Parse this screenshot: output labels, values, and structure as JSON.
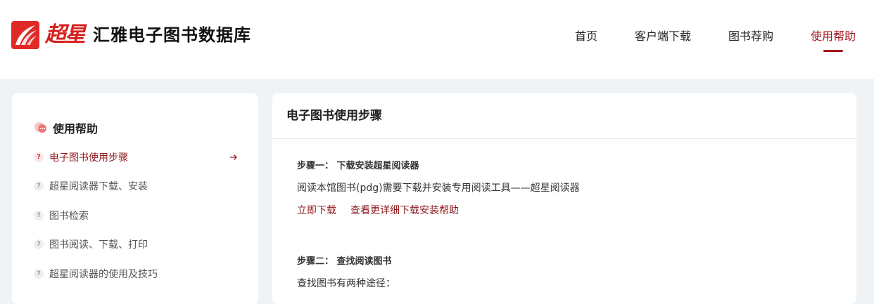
{
  "header": {
    "logo_script": "超星",
    "title": "汇雅电子图书数据库",
    "nav": [
      {
        "label": "首页",
        "active": false
      },
      {
        "label": "客户端下载",
        "active": false
      },
      {
        "label": "图书荐购",
        "active": false
      },
      {
        "label": "使用帮助",
        "active": true
      }
    ],
    "accent_color": "#a2151a"
  },
  "sidebar": {
    "title": "使用帮助",
    "items": [
      {
        "label": "电子图书使用步骤",
        "active": true
      },
      {
        "label": "超星阅读器下载、安装",
        "active": false
      },
      {
        "label": "图书检索",
        "active": false
      },
      {
        "label": "图书阅读、下载、打印",
        "active": false
      },
      {
        "label": "超星阅读器的使用及技巧",
        "active": false
      }
    ],
    "item_icon": "question-icon",
    "active_arrow_icon": "arrow-right-icon"
  },
  "content": {
    "title": "电子图书使用步骤",
    "step1": {
      "heading": "步骤一：  下载安装超星阅读器",
      "text": "阅读本馆图书(pdg)需要下载并安装专用阅读工具——超星阅读器",
      "links": [
        "立即下载",
        "查看更详细下载安装帮助"
      ]
    },
    "step2": {
      "heading": "步骤二：  查找阅读图书",
      "text": "查找图书有两种途径："
    }
  }
}
